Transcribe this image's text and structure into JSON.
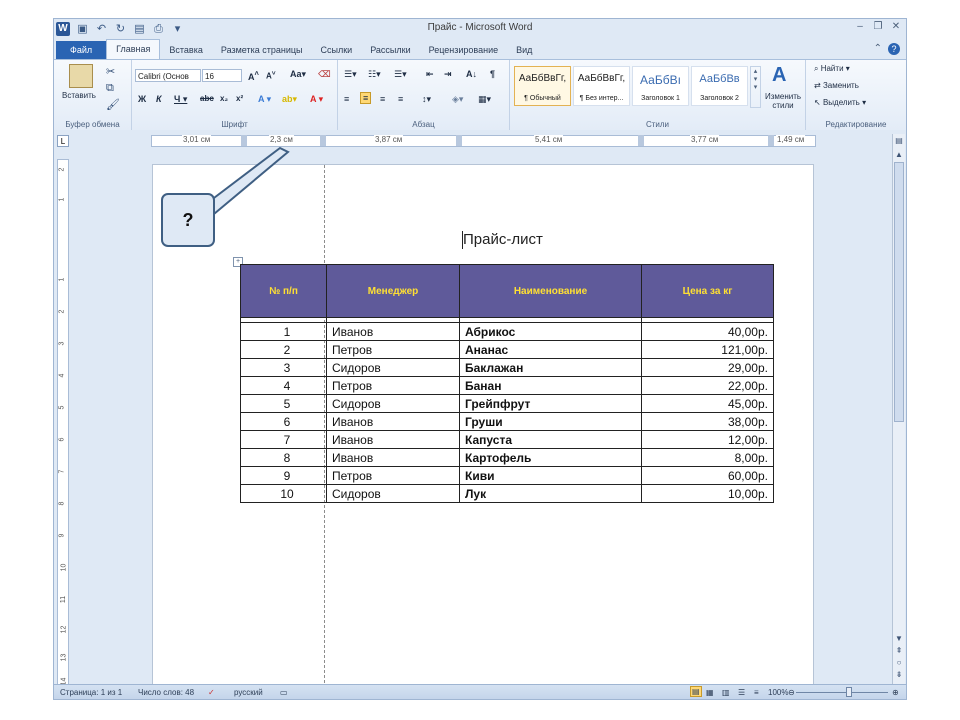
{
  "window": {
    "title": "Прайс - Microsoft Word"
  },
  "qat": {
    "logo": "W",
    "save_icon": "save-icon",
    "undo_icon": "undo-icon"
  },
  "tabs": [
    {
      "label": "Файл"
    },
    {
      "label": "Главная"
    },
    {
      "label": "Вставка"
    },
    {
      "label": "Разметка страницы"
    },
    {
      "label": "Ссылки"
    },
    {
      "label": "Рассылки"
    },
    {
      "label": "Рецензирование"
    },
    {
      "label": "Вид"
    }
  ],
  "ribbon": {
    "clipboard": {
      "label": "Буфер обмена",
      "paste": "Вставить"
    },
    "font": {
      "label": "Шрифт",
      "family": "Calibri (Основ",
      "size": "16"
    },
    "paragraph": {
      "label": "Абзац"
    },
    "styles": {
      "label": "Стили",
      "items": [
        {
          "sample": "АаБбВвГг,",
          "name": "¶ Обычный"
        },
        {
          "sample": "АаБбВвГг,",
          "name": "¶ Без интер..."
        },
        {
          "sample": "АаБбВı",
          "name": "Заголовок 1"
        },
        {
          "sample": "АаБбВв",
          "name": "Заголовок 2"
        }
      ],
      "change": "Изменить стили"
    },
    "editing": {
      "label": "Редактирование",
      "find": "Найти",
      "replace": "Заменить",
      "select": "Выделить"
    }
  },
  "ruler": {
    "tab_selector": "L",
    "labels": [
      "3,01 см",
      "2,3 см",
      "3,87 см",
      "5,41 см",
      "3,77 см",
      "1,49 см"
    ],
    "vnums": [
      "2",
      "1",
      "1",
      "2",
      "3",
      "4",
      "5",
      "6",
      "7",
      "8",
      "9",
      "10",
      "11",
      "12",
      "13",
      "14"
    ]
  },
  "document": {
    "title": "Прайс-лист",
    "table": {
      "headers": [
        "№ п/п",
        "Менеджер",
        "Наименование",
        "Цена за кг"
      ],
      "rows": [
        {
          "n": "1",
          "manager": "Иванов",
          "name": "Абрикос",
          "price": "40,00р."
        },
        {
          "n": "2",
          "manager": "Петров",
          "name": "Ананас",
          "price": "121,00р."
        },
        {
          "n": "3",
          "manager": "Сидоров",
          "name": "Баклажан",
          "price": "29,00р."
        },
        {
          "n": "4",
          "manager": "Петров",
          "name": "Банан",
          "price": "22,00р."
        },
        {
          "n": "5",
          "manager": "Сидоров",
          "name": "Грейпфрут",
          "price": "45,00р."
        },
        {
          "n": "6",
          "manager": "Иванов",
          "name": "Груши",
          "price": "38,00р."
        },
        {
          "n": "7",
          "manager": "Иванов",
          "name": "Капуста",
          "price": "12,00р."
        },
        {
          "n": "8",
          "manager": "Иванов",
          "name": "Картофель",
          "price": "8,00р."
        },
        {
          "n": "9",
          "manager": "Петров",
          "name": "Киви",
          "price": "60,00р."
        },
        {
          "n": "10",
          "manager": "Сидоров",
          "name": "Лук",
          "price": "10,00р."
        }
      ]
    }
  },
  "callout": {
    "text": "?"
  },
  "status": {
    "page": "Страница: 1 из 1",
    "words": "Число слов: 48",
    "language": "русский",
    "zoom": "100%"
  }
}
